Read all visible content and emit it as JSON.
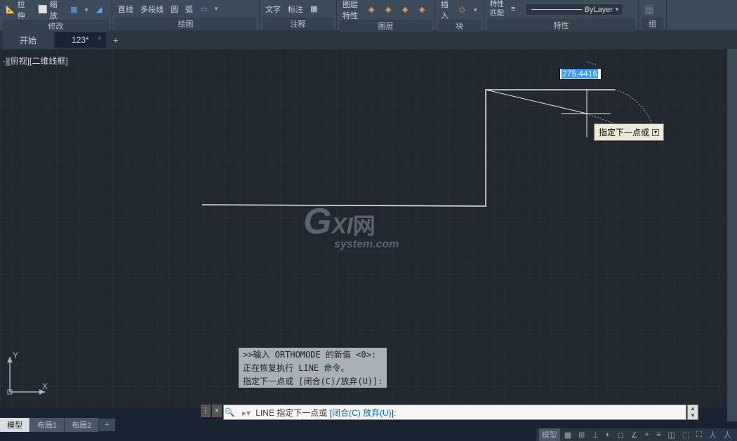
{
  "ribbon": {
    "panels": {
      "modify": {
        "title": "修改",
        "stretch": "拉伸",
        "scale": "缩放"
      },
      "draw": {
        "title": "绘图",
        "line": "直线",
        "polyline": "多段线",
        "circle": "圆",
        "arc": "弧"
      },
      "annotate": {
        "title": "注释",
        "text": "文字",
        "dim": "标注",
        "table": "表格"
      },
      "layer": {
        "title": "图层",
        "props": "图层特性"
      },
      "block": {
        "title": "块",
        "insert": "插入"
      },
      "props": {
        "title": "特性",
        "match": "特性匹配",
        "bylayer": "ByLayer"
      },
      "group": {
        "title": "组"
      }
    }
  },
  "tabs": {
    "start": "开始",
    "doc": "123*"
  },
  "viewport": {
    "label": "-][俯视][二维线框]"
  },
  "dimension": {
    "value": "275.4416"
  },
  "tooltip": {
    "text": "指定下一点或"
  },
  "watermark": {
    "line1": "GXI网",
    "line2": "system.com"
  },
  "ucs": {
    "x": "X",
    "y": "Y"
  },
  "cmd_history": {
    "l1": ">>输入 ORTHOMODE 的新值 <0>:",
    "l2": "正在恢复执行 LINE 命令。",
    "l3": "指定下一点或 [闭合(C)/放弃(U)]:"
  },
  "cmd_line": {
    "prefix": "LINE",
    "text1": " 指定下一点或 [",
    "close": "闭合(C)",
    "sep": " ",
    "undo": "放弃(U)",
    "suffix": "]:"
  },
  "layout": {
    "model": "模型",
    "l1": "布局1",
    "l2": "布局2"
  },
  "status": {
    "model": "模型"
  }
}
